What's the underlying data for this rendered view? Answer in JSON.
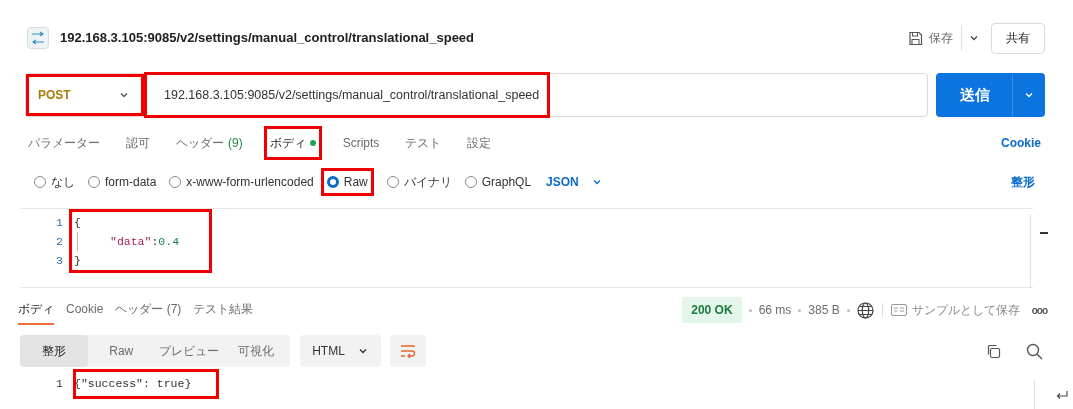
{
  "request": {
    "title": "192.168.3.105:9085/v2/settings/manual_control/translational_speed",
    "save_label": "保存",
    "share_label": "共有",
    "method": "POST",
    "method_highlighted": true,
    "url": "192.168.3.105:9085/v2/settings/manual_control/translational_speed",
    "url_highlighted": true,
    "send_label": "送信"
  },
  "request_tabs": [
    {
      "label": "パラメーター",
      "selected": false,
      "dot": false,
      "highlighted": false
    },
    {
      "label": "認可",
      "selected": false,
      "dot": false,
      "highlighted": false
    },
    {
      "label": "ヘッダー",
      "count": "(9)",
      "selected": false,
      "dot": false,
      "highlighted": false
    },
    {
      "label": "ボディ",
      "selected": true,
      "dot": true,
      "highlighted": true
    },
    {
      "label": "Scripts",
      "selected": false,
      "dot": false,
      "highlighted": false
    },
    {
      "label": "テスト",
      "selected": false,
      "dot": false,
      "highlighted": false
    },
    {
      "label": "設定",
      "selected": false,
      "dot": false,
      "highlighted": false
    }
  ],
  "cookie_link": "Cookie",
  "body_types": [
    {
      "label": "なし",
      "selected": false,
      "highlighted": false
    },
    {
      "label": "form-data",
      "selected": false,
      "highlighted": false
    },
    {
      "label": "x-www-form-urlencoded",
      "selected": false,
      "highlighted": false
    },
    {
      "label": "Raw",
      "selected": true,
      "highlighted": true
    },
    {
      "label": "バイナリ",
      "selected": false,
      "highlighted": false
    },
    {
      "label": "GraphQL",
      "selected": false,
      "highlighted": false
    }
  ],
  "raw_format": "JSON",
  "beautify_link": "整形",
  "editor": {
    "highlighted": true,
    "lines": [
      {
        "number": "1",
        "tokens": [
          {
            "kind": "punct",
            "text": "{"
          }
        ]
      },
      {
        "number": "2",
        "tokens": [
          {
            "kind": "key",
            "text": "\"data\""
          },
          {
            "kind": "punct",
            "text": ":"
          },
          {
            "kind": "number",
            "text": "0.4"
          }
        ]
      },
      {
        "number": "3",
        "tokens": [
          {
            "kind": "punct",
            "text": "}"
          }
        ]
      }
    ]
  },
  "response_tabs": [
    {
      "label": "ボディ",
      "selected": true
    },
    {
      "label": "Cookie",
      "selected": false
    },
    {
      "label": "ヘッダー (7)",
      "selected": false
    },
    {
      "label": "テスト結果",
      "selected": false
    }
  ],
  "response_meta": {
    "status": "200 OK",
    "time": "66 ms",
    "size": "385 B",
    "save_example": "サンプルとして保存",
    "more": "ooo"
  },
  "view_modes": [
    {
      "label": "整形",
      "selected": true
    },
    {
      "label": "Raw",
      "selected": false
    },
    {
      "label": "プレビュー",
      "selected": false
    },
    {
      "label": "可視化",
      "selected": false
    }
  ],
  "response_format": "HTML",
  "response_body": {
    "highlighted": true,
    "lines": [
      {
        "number": "1",
        "text": "{\"success\": true}"
      }
    ]
  }
}
